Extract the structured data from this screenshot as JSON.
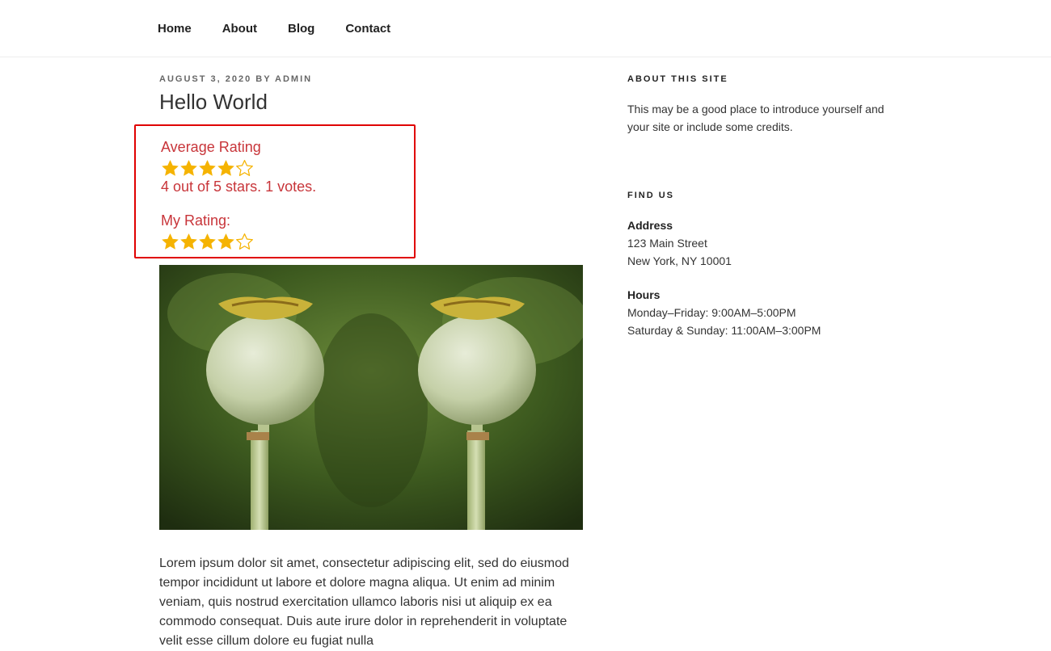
{
  "nav": {
    "items": [
      "Home",
      "About",
      "Blog",
      "Contact"
    ]
  },
  "post": {
    "date": "AUGUST 3, 2020",
    "by": "BY",
    "author": "ADMIN",
    "title": "Hello World",
    "rating": {
      "average_label": "Average Rating",
      "average_stars": 4,
      "max_stars": 5,
      "summary": "4 out of 5 stars. 1 votes.",
      "my_label": "My Rating:",
      "my_stars": 4
    },
    "body": "Lorem ipsum dolor sit amet, consectetur adipiscing elit, sed do eiusmod tempor incididunt ut labore et dolore magna aliqua. Ut enim ad minim veniam, quis nostrud exercitation ullamco laboris nisi ut aliquip ex ea commodo consequat. Duis aute irure dolor in reprehenderit in voluptate velit esse cillum dolore eu fugiat nulla"
  },
  "sidebar": {
    "about": {
      "title": "ABOUT THIS SITE",
      "text": "This may be a good place to introduce yourself and your site or include some credits."
    },
    "find": {
      "title": "FIND US",
      "address_label": "Address",
      "address_lines": [
        "123 Main Street",
        "New York, NY 10001"
      ],
      "hours_label": "Hours",
      "hours_lines": [
        "Monday–Friday: 9:00AM–5:00PM",
        "Saturday & Sunday: 11:00AM–3:00PM"
      ]
    }
  },
  "colors": {
    "accent": "#c8353a",
    "star": "#f5b301",
    "highlight": "#e00000"
  }
}
